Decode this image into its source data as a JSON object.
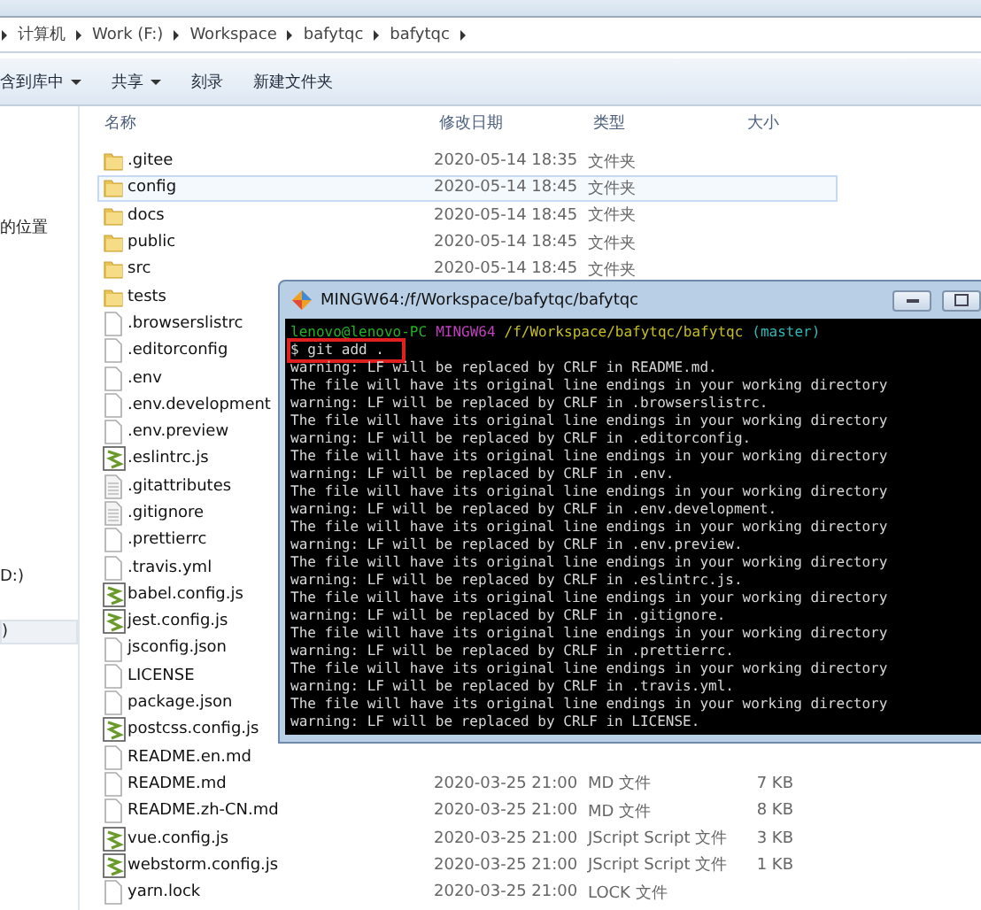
{
  "address_bar": {
    "segments": [
      "计算机",
      "Work (F:)",
      "Workspace",
      "bafytqc",
      "bafytqc"
    ]
  },
  "toolbar": {
    "items": [
      {
        "label": "含到库中",
        "dropdown": true
      },
      {
        "label": "共享",
        "dropdown": true
      },
      {
        "label": "刻录",
        "dropdown": false
      },
      {
        "label": "新建文件夹",
        "dropdown": false
      }
    ]
  },
  "nav_pane": {
    "items": [
      {
        "label": "的位置",
        "selected": false
      },
      {
        "label": "D:)",
        "selected": false
      },
      {
        "label": ")",
        "selected": true
      }
    ]
  },
  "file_list": {
    "columns": [
      "名称",
      "修改日期",
      "类型",
      "大小"
    ],
    "rows": [
      {
        "name": ".gitee",
        "kind": "folder",
        "date": "2020-05-14 18:35",
        "type": "文件夹",
        "selected": false
      },
      {
        "name": "config",
        "kind": "folder",
        "date": "2020-05-14 18:45",
        "type": "文件夹",
        "selected": true
      },
      {
        "name": "docs",
        "kind": "folder",
        "date": "2020-05-14 18:45",
        "type": "文件夹",
        "selected": false
      },
      {
        "name": "public",
        "kind": "folder",
        "date": "2020-05-14 18:45",
        "type": "文件夹",
        "selected": false
      },
      {
        "name": "src",
        "kind": "folder",
        "date": "2020-05-14 18:45",
        "type": "文件夹",
        "selected": false
      },
      {
        "name": "tests",
        "kind": "folder",
        "selected": false
      },
      {
        "name": ".browserslistrc",
        "kind": "file",
        "selected": false
      },
      {
        "name": ".editorconfig",
        "kind": "file",
        "selected": false
      },
      {
        "name": ".env",
        "kind": "file",
        "selected": false
      },
      {
        "name": ".env.development",
        "kind": "file",
        "selected": false
      },
      {
        "name": ".env.preview",
        "kind": "file",
        "selected": false
      },
      {
        "name": ".eslintrc.js",
        "kind": "script",
        "selected": false
      },
      {
        "name": ".gitattributes",
        "kind": "text",
        "selected": false
      },
      {
        "name": ".gitignore",
        "kind": "text",
        "selected": false
      },
      {
        "name": ".prettierrc",
        "kind": "file",
        "selected": false
      },
      {
        "name": ".travis.yml",
        "kind": "file",
        "selected": false
      },
      {
        "name": "babel.config.js",
        "kind": "script",
        "selected": false
      },
      {
        "name": "jest.config.js",
        "kind": "script",
        "selected": false
      },
      {
        "name": "jsconfig.json",
        "kind": "file",
        "selected": false
      },
      {
        "name": "LICENSE",
        "kind": "file",
        "selected": false
      },
      {
        "name": "package.json",
        "kind": "file",
        "selected": false
      },
      {
        "name": "postcss.config.js",
        "kind": "script",
        "selected": false
      },
      {
        "name": "README.en.md",
        "kind": "file",
        "selected": false
      },
      {
        "name": "README.md",
        "kind": "file",
        "date": "2020-03-25 21:00",
        "type": "MD 文件",
        "size": "7 KB",
        "selected": false
      },
      {
        "name": "README.zh-CN.md",
        "kind": "file",
        "date": "2020-03-25 21:00",
        "type": "MD 文件",
        "size": "8 KB",
        "selected": false
      },
      {
        "name": "vue.config.js",
        "kind": "script",
        "date": "2020-03-25 21:00",
        "type": "JScript Script 文件",
        "size": "3 KB",
        "selected": false
      },
      {
        "name": "webstorm.config.js",
        "kind": "script",
        "date": "2020-03-25 21:00",
        "type": "JScript Script 文件",
        "size": "1 KB",
        "selected": false
      },
      {
        "name": "yarn.lock",
        "kind": "file",
        "date": "2020-03-25 21:00",
        "type": "LOCK 文件",
        "selected": false
      }
    ]
  },
  "terminal": {
    "title": "MINGW64:/f/Workspace/bafytqc/bafytqc",
    "prompt": {
      "user": "lenovo@lenovo-PC",
      "system": "MINGW64",
      "path": "/f/Workspace/bafytqc/bafytqc",
      "branch": "(master)"
    },
    "command": "$ git add .",
    "output": [
      "warning: LF will be replaced by CRLF in README.md.",
      "The file will have its original line endings in your working directory",
      "warning: LF will be replaced by CRLF in .browserslistrc.",
      "The file will have its original line endings in your working directory",
      "warning: LF will be replaced by CRLF in .editorconfig.",
      "The file will have its original line endings in your working directory",
      "warning: LF will be replaced by CRLF in .env.",
      "The file will have its original line endings in your working directory",
      "warning: LF will be replaced by CRLF in .env.development.",
      "The file will have its original line endings in your working directory",
      "warning: LF will be replaced by CRLF in .env.preview.",
      "The file will have its original line endings in your working directory",
      "warning: LF will be replaced by CRLF in .eslintrc.js.",
      "The file will have its original line endings in your working directory",
      "warning: LF will be replaced by CRLF in .gitignore.",
      "The file will have its original line endings in your working directory",
      "warning: LF will be replaced by CRLF in .prettierrc.",
      "The file will have its original line endings in your working directory",
      "warning: LF will be replaced by CRLF in .travis.yml.",
      "The file will have its original line endings in your working directory",
      "warning: LF will be replaced by CRLF in LICENSE."
    ]
  }
}
